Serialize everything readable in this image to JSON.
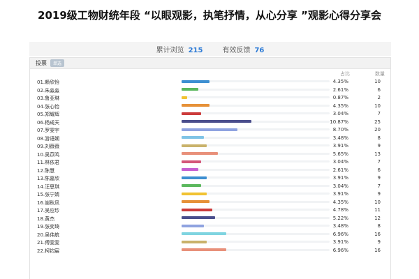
{
  "title": "2019级工物财统年段 “以眼观影，执笔抒情，从心分享 ”观影心得分享会",
  "stats": {
    "views_label": "累计浏览",
    "views_value": "215",
    "feedback_label": "有效反馈",
    "feedback_value": "76"
  },
  "panel": {
    "label": "投票",
    "tag": "单选"
  },
  "columns": {
    "percent": "占比",
    "count": "数量"
  },
  "rows": [
    {
      "name": "01.赖欣怡",
      "percent": "4.35%",
      "count": "10",
      "value": 4.35,
      "color": "#3d8fd1"
    },
    {
      "name": "02.朱淼淼",
      "percent": "2.61%",
      "count": "6",
      "value": 2.61,
      "color": "#5bb85d"
    },
    {
      "name": "03.鲁亚琳",
      "percent": "0.87%",
      "count": "2",
      "value": 0.87,
      "color": "#f1c232"
    },
    {
      "name": "04.张心怡",
      "percent": "4.35%",
      "count": "10",
      "value": 4.35,
      "color": "#e69138"
    },
    {
      "name": "05.郑耀辉",
      "percent": "3.04%",
      "count": "7",
      "value": 3.04,
      "color": "#cc3b3b"
    },
    {
      "name": "06.杨成天",
      "percent": "10.87%",
      "count": "25",
      "value": 10.87,
      "color": "#4a4e8c"
    },
    {
      "name": "07.罗雯宇",
      "percent": "8.70%",
      "count": "20",
      "value": 8.7,
      "color": "#8fa3e0"
    },
    {
      "name": "08.游语娴",
      "percent": "3.48%",
      "count": "8",
      "value": 3.48,
      "color": "#7fc4e6"
    },
    {
      "name": "09.刘薇薇",
      "percent": "3.91%",
      "count": "9",
      "value": 3.91,
      "color": "#c9b26b"
    },
    {
      "name": "10.吴苡鸣",
      "percent": "5.65%",
      "count": "13",
      "value": 5.65,
      "color": "#e8907a"
    },
    {
      "name": "11.林依君",
      "percent": "3.04%",
      "count": "7",
      "value": 3.04,
      "color": "#d4577a"
    },
    {
      "name": "12.陈慧",
      "percent": "2.61%",
      "count": "6",
      "value": 2.61,
      "color": "#c65fd1"
    },
    {
      "name": "13.陈嘉欣",
      "percent": "3.91%",
      "count": "9",
      "value": 3.91,
      "color": "#3d8fd1"
    },
    {
      "name": "14.汪思琪",
      "percent": "3.04%",
      "count": "7",
      "value": 3.04,
      "color": "#5bb85d"
    },
    {
      "name": "15.张宁婧",
      "percent": "3.91%",
      "count": "9",
      "value": 3.91,
      "color": "#f1c232"
    },
    {
      "name": "16.谢秋凤",
      "percent": "4.35%",
      "count": "10",
      "value": 4.35,
      "color": "#e69138"
    },
    {
      "name": "17.吴应珍",
      "percent": "4.78%",
      "count": "11",
      "value": 4.78,
      "color": "#cc3b3b"
    },
    {
      "name": "18.黄杰",
      "percent": "5.22%",
      "count": "12",
      "value": 5.22,
      "color": "#4a4e8c"
    },
    {
      "name": "19.张奕琦",
      "percent": "3.48%",
      "count": "8",
      "value": 3.48,
      "color": "#8fa3e0"
    },
    {
      "name": "20.吴伟航",
      "percent": "6.96%",
      "count": "16",
      "value": 6.96,
      "color": "#7fd4e0"
    },
    {
      "name": "21.傅雯雯",
      "percent": "3.91%",
      "count": "9",
      "value": 3.91,
      "color": "#c9b26b"
    },
    {
      "name": "22.柯钧宸",
      "percent": "6.96%",
      "count": "16",
      "value": 6.96,
      "color": "#e8907a"
    }
  ]
}
